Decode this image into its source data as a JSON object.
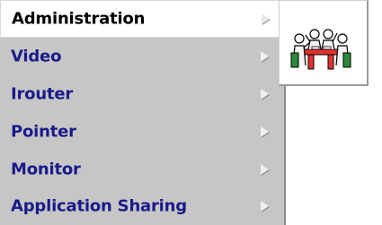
{
  "menu": {
    "items": [
      {
        "label": "Administration",
        "selected": true
      },
      {
        "label": "Video"
      },
      {
        "label": "Irouter"
      },
      {
        "label": "Pointer"
      },
      {
        "label": "Monitor"
      },
      {
        "label": "Application Sharing"
      }
    ]
  },
  "submenu": {
    "icon": "meeting-icon"
  },
  "colors": {
    "menu_bg": "#c6c6c6",
    "label_text": "#1a1a8a",
    "selected_bg": "#ffffff"
  }
}
